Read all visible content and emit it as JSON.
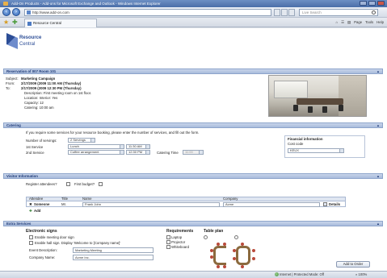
{
  "window": {
    "title": "Add-On Products - Add-ons for Microsoft Exchange and Outlook - Windows Internet Explorer"
  },
  "browser": {
    "url": "http://www.add-on.com",
    "search_placeholder": "Live Search",
    "tab_label": "Resource Central",
    "commands": [
      "Page",
      "Tools",
      "Help"
    ]
  },
  "app": {
    "logo_line1": "Resource",
    "logo_line2": "Central"
  },
  "reservation": {
    "header": "Reservation of 007 Room 101",
    "subject_label": "Subject:",
    "subject_value": "Marketing Campaign",
    "from_label": "From:",
    "from_value": "2/17/2009 (2009 11:00 AM (Thursday)",
    "to_label": "To:",
    "to_value": "2/17/2009 (2009 12:30 PM (Thursday)",
    "description": "Description:  First meeting room on 1st floor.",
    "location": "Location: Interior: Yes",
    "capacity": "Capacity: 12",
    "catering": "Catering: 10:00 am"
  },
  "catering": {
    "header": "Catering",
    "intro": "If you require some services for your resource booking, please enter the number of services, and fill out the form.",
    "servings_label": "Number of servings:",
    "servings_value": "2 Servings",
    "row1_label": "1st Service",
    "row1_item": "Lunch",
    "row1_time": "11:30 AM",
    "row2_label": "2nd Service",
    "row2_item": "Coffee arrangement",
    "row2_time": "12:30 PM",
    "catering_time_label": "Catering Time",
    "catering_time_value": "11:00",
    "financial_header": "Financial information",
    "cost_code_label": "Cost code",
    "cost_code_value": "KEUX"
  },
  "visitor": {
    "header": "Visitor Information",
    "register_label": "Register attendees?",
    "first_budget_label": "First budget?",
    "col_attendee": "Attendee",
    "col_title": "Title",
    "col_name": "Name",
    "col_company": "Company",
    "row_attendee": "Someone",
    "row_title": "Mr.",
    "row_name": "Frank John",
    "row_company": "Acme",
    "details_label": "Details",
    "add_label": "Add"
  },
  "extra": {
    "header": "Extra Services",
    "signs_header": "Electronic signs",
    "sign1": "Enable meeting door sign",
    "sign2": "Enable hall sign. Display 'Welcome to [Company name]'",
    "event_desc_label": "Event Description:",
    "event_desc_value": "Marketing Meeting",
    "company_label": "Company Name:",
    "company_value": "Acme Inc.",
    "requirements_header": "Requirements",
    "req1": "Laptop",
    "req2": "Projector",
    "req3": "Whiteboard",
    "tableplan_header": "Table plan",
    "submit_label": "Add to Order"
  },
  "status": {
    "zone": "Internet | Protected Mode: Off",
    "zoom": "100%"
  },
  "colors": {
    "section_bar": "#a9bcdc",
    "brand": "#2c4d96",
    "title_bar": "#4a6ea8"
  }
}
